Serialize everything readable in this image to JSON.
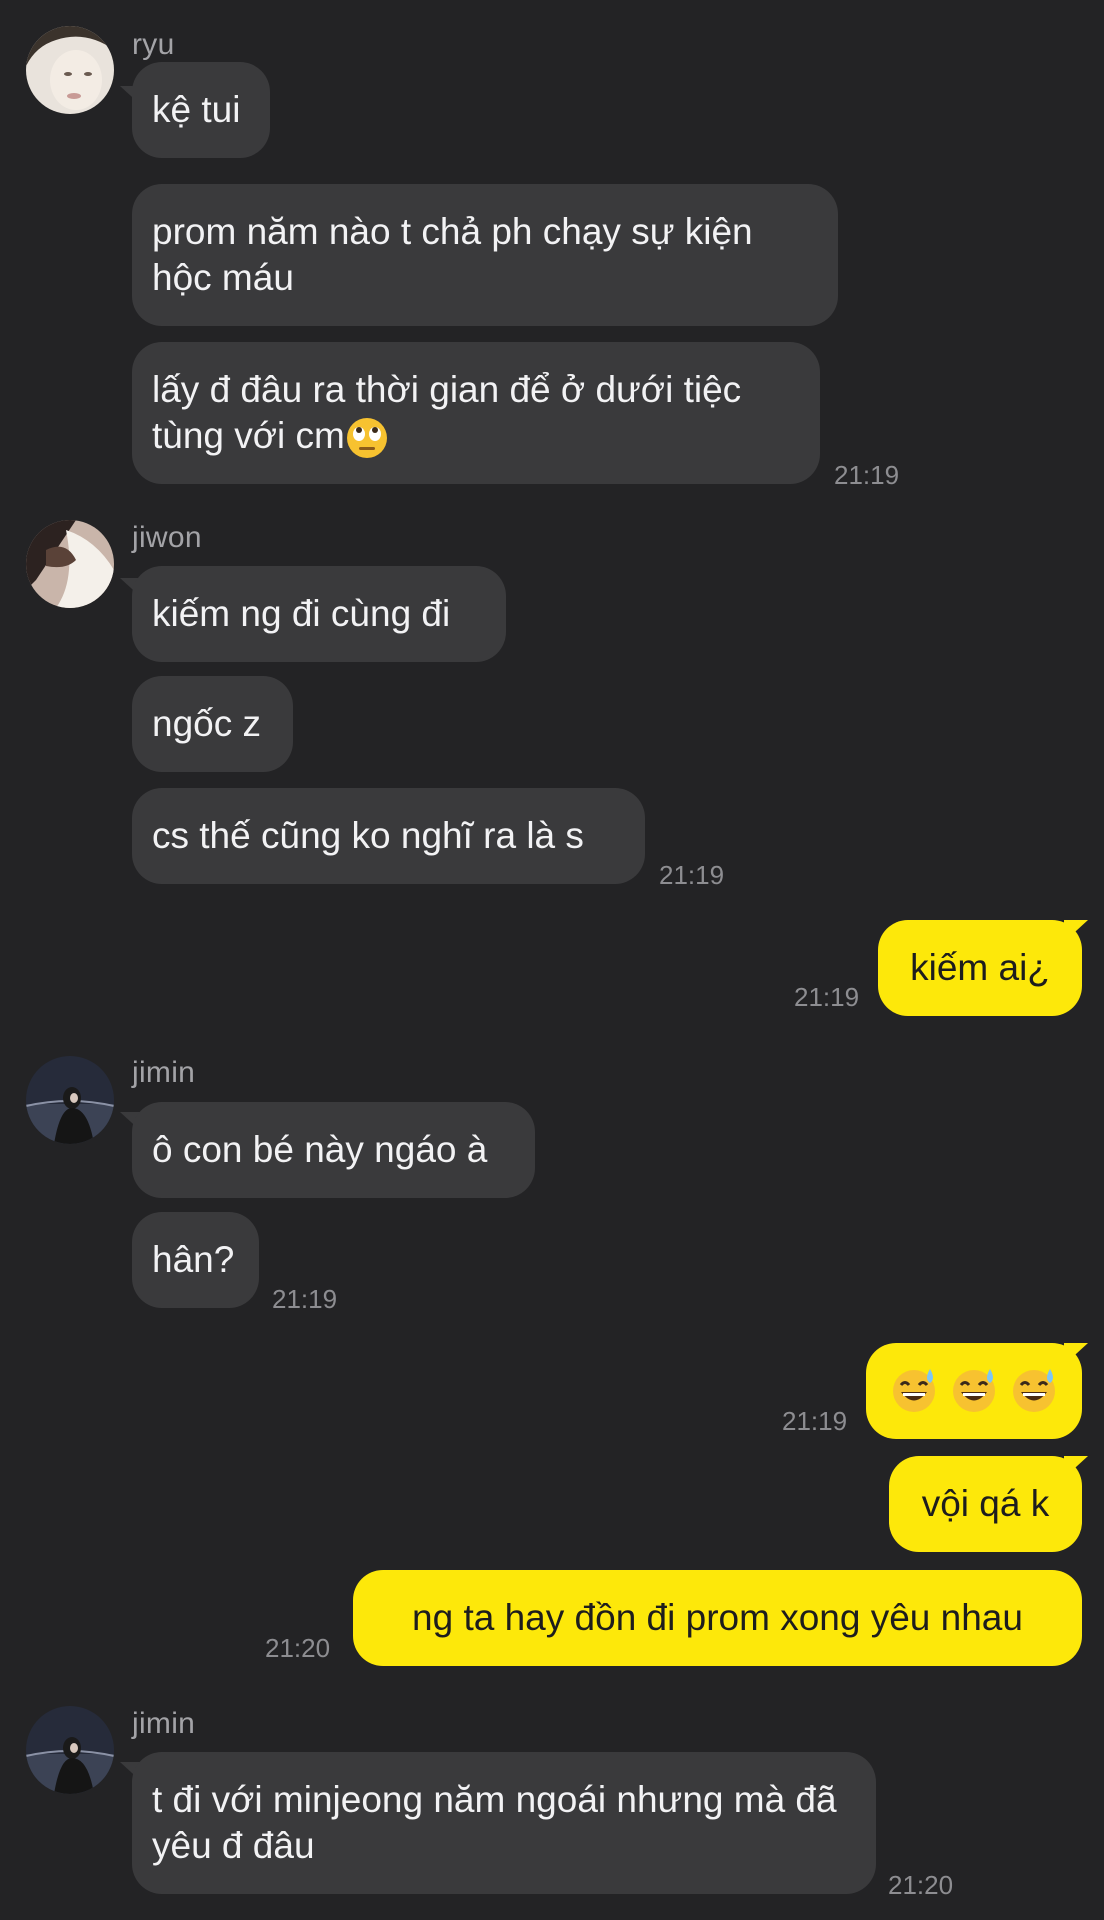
{
  "chat": {
    "groups": [
      {
        "sender": "ryu",
        "avatar_icon": "user-photo-avatar",
        "messages": [
          "kệ tui",
          "prom năm nào t chả ph chạy sự kiện hộc máu",
          "lấy đ đâu ra thời gian để ở dưới tiệc tùng với cm"
        ],
        "emoji": "face-with-rolling-eyes",
        "time": "21:19"
      },
      {
        "sender": "jiwon",
        "avatar_icon": "user-photo-avatar",
        "messages": [
          "kiếm ng đi cùng đi",
          "ngốc z",
          "cs thế cũng ko nghĩ ra là s"
        ],
        "time": "21:19"
      },
      {
        "from_me": true,
        "messages": [
          "kiếm ai¿"
        ],
        "time": "21:19"
      },
      {
        "sender": "jimin",
        "avatar_icon": "user-photo-avatar",
        "messages": [
          "ô con bé này ngáo à",
          "hân?"
        ],
        "time": "21:19"
      },
      {
        "from_me": true,
        "messages": [
          "vội qá k"
        ],
        "emoji_message": "grinning-face-with-sweat x3",
        "time": "21:19"
      },
      {
        "from_me": true,
        "messages": [
          "ng ta hay đồn đi prom xong yêu nhau"
        ],
        "time": "21:20"
      },
      {
        "sender": "jimin",
        "avatar_icon": "user-photo-avatar",
        "messages": [
          "t đi với minjeong năm ngoái nhưng mà đã yêu đ đâu"
        ],
        "time": "21:20"
      }
    ]
  },
  "colors": {
    "background": "#232325",
    "incoming_bubble": "#3a3a3c",
    "outgoing_bubble": "#fde80a",
    "sender_name": "#a3a3a7",
    "timestamp": "#8d8d91"
  }
}
